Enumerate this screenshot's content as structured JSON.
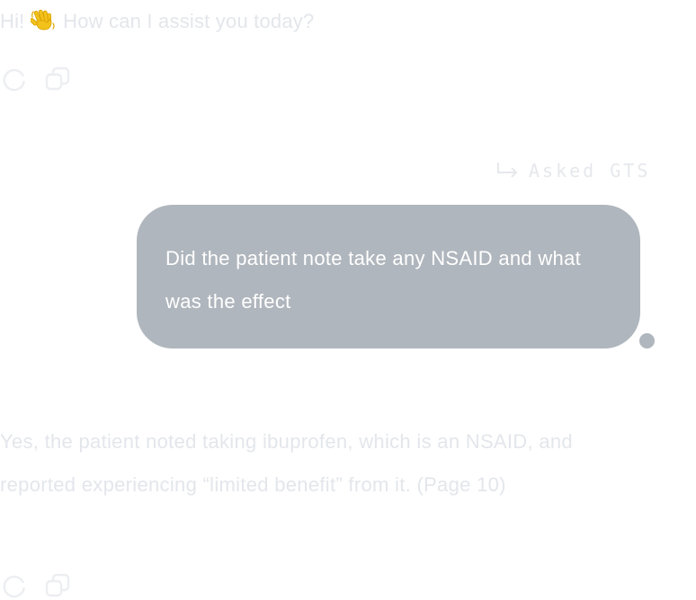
{
  "greeting": {
    "prefix": "Hi!",
    "text": "How can I assist you today?",
    "emoji": "waving-hand-icon"
  },
  "asked": {
    "label": "Asked GTS",
    "icon": "reply-arrow-icon"
  },
  "user_message": {
    "text": "Did the patient note take any NSAID and what was the effect"
  },
  "assistant_reply": {
    "text": "Yes, the patient noted taking ibuprofen, which is an NSAID, and reported experiencing “limited benefit” from it. (Page 10)"
  },
  "message_actions": [
    "regenerate-icon",
    "copy-icon"
  ],
  "colors": {
    "bubble": "#b0b6bd",
    "faded_text": "#e3e6eb",
    "bubble_text": "#ffffff"
  }
}
